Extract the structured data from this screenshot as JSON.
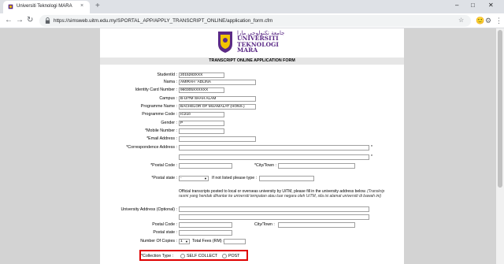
{
  "browser": {
    "tab_title": "Universiti Teknologi MARA",
    "tab_close": "×",
    "new_tab": "+",
    "window_controls": [
      "–",
      "□",
      "✕"
    ],
    "nav": {
      "back": "←",
      "forward": "→",
      "reload": "↻"
    },
    "url": "https://simsweb.uitm.edu.my/SPORTAL_APP/APPLY_TRANSCRIPT_ONLINE/application_form.cfm",
    "star_icon": "☆",
    "ext_icons": [
      "🙂",
      "⚙",
      "⋮"
    ]
  },
  "logo": {
    "script_text": "ﺟﺎﻣﻌﺔ ﺗﻜﻨﻮﻟﻮﺟﻲ ﻣﺎرا",
    "name": "UNIVERSITI\nTEKNOLOGI\nMARA",
    "color": "#5b2a86"
  },
  "form": {
    "title": "TRANSCRIPT ONLINE APPLICATION FORM",
    "fields": {
      "student_id": {
        "label": "StudentId :",
        "value": "2015283XXX"
      },
      "name": {
        "label": "Nama :",
        "value": "AMIRAH `ADLINA"
      },
      "ic_number": {
        "label": "Identity Card Number :",
        "value": "960305XXXXXX"
      },
      "campus": {
        "label": "Campus :",
        "value": "B-UITM SHAH ALAM"
      },
      "programme_name": {
        "label": "Programme Name :",
        "value": "BACHELOR OF MUAMALAT (HONS.)"
      },
      "programme_code": {
        "label": "Programme Code :",
        "value": "IC210"
      },
      "gender": {
        "label": "Gender :",
        "value": "P"
      },
      "mobile": {
        "label": "*Mobile Number :",
        "value": ""
      },
      "email": {
        "label": "*Email Address :",
        "value": ""
      },
      "corr_address": {
        "label": "*Correspondence Address :",
        "value": ""
      },
      "postal_code": {
        "label": "*Postal Code :",
        "value": ""
      },
      "city": {
        "label": "*City/Town :",
        "value": ""
      },
      "postal_state": {
        "label": "*Postal state :",
        "value": "-"
      },
      "state_other": {
        "label": "If not listed please type :",
        "value": ""
      },
      "uni_address": {
        "label": "University Address (Optional) :",
        "value": ""
      },
      "uni_postal_code": {
        "label": "Postal Code :",
        "value": ""
      },
      "uni_city": {
        "label": "City/Town :",
        "value": ""
      },
      "uni_state": {
        "label": "Postal state :",
        "value": ""
      },
      "copies": {
        "label": "Number Of Copies :",
        "value": "1"
      },
      "total_fees": {
        "label": "Total Fees (RM) :",
        "value": ""
      },
      "collection_type": {
        "label": "*Collection Type :",
        "options": [
          "SELF COLLECT",
          "POST"
        ],
        "selected": ""
      }
    },
    "required_mark": "*",
    "note_en": "Official transcripts posted to local or overseas university by UiTM, please fill in the university address below.",
    "note_ms": "(Transkrip rasmi yang hendak dihantar ke universiti tempatan atau luar negara oleh UiTM, sila isi alamat universiti di bawah ini)",
    "highlight_color": "#e00000"
  }
}
